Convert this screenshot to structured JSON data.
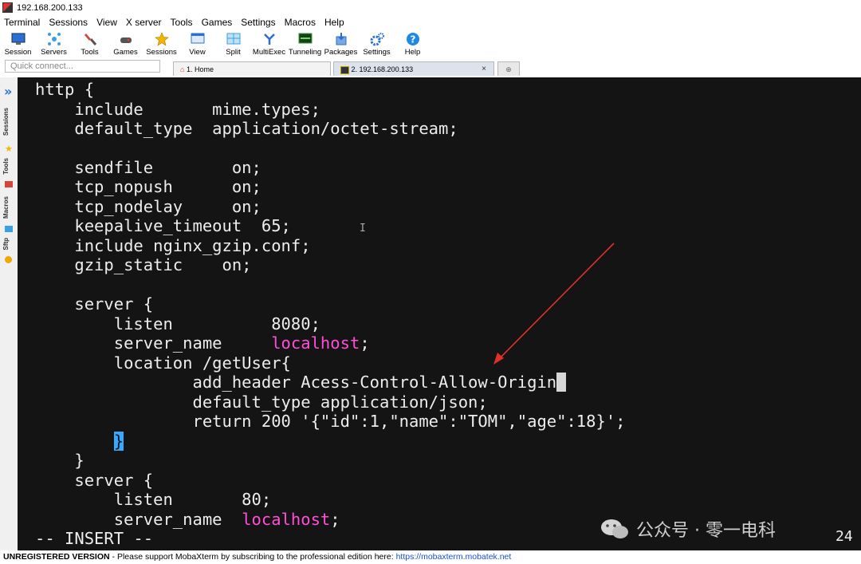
{
  "window": {
    "title": "192.168.200.133"
  },
  "menu": [
    "Terminal",
    "Sessions",
    "View",
    "X server",
    "Tools",
    "Games",
    "Settings",
    "Macros",
    "Help"
  ],
  "toolbar": [
    {
      "label": "Session",
      "icon": "session-icon",
      "color": "#2a6fd6"
    },
    {
      "label": "Servers",
      "icon": "servers-icon",
      "color": "#3aa0e6"
    },
    {
      "label": "Tools",
      "icon": "tools-icon",
      "color": "#d9443a"
    },
    {
      "label": "Games",
      "icon": "games-icon",
      "color": "#555555"
    },
    {
      "label": "Sessions",
      "icon": "star-icon",
      "color": "#f2b600"
    },
    {
      "label": "View",
      "icon": "view-icon",
      "color": "#2a6fd6"
    },
    {
      "label": "Split",
      "icon": "split-icon",
      "color": "#3aa0e6"
    },
    {
      "label": "MultiExec",
      "icon": "multiexec-icon",
      "color": "#2a6fd6"
    },
    {
      "label": "Tunneling",
      "icon": "tunneling-icon",
      "color": "#3a9a3a"
    },
    {
      "label": "Packages",
      "icon": "packages-icon",
      "color": "#2a6fd6"
    },
    {
      "label": "Settings",
      "icon": "gear-icon",
      "color": "#2a6fd6"
    },
    {
      "label": "Help",
      "icon": "help-icon",
      "color": "#1e88e5"
    }
  ],
  "quick_connect": {
    "placeholder": "Quick connect..."
  },
  "tabs": [
    {
      "label": "1. Home",
      "icon": "home-icon"
    },
    {
      "label": "2. 192.168.200.133",
      "icon": "terminal-icon",
      "close": "×"
    }
  ],
  "sidebar": {
    "chevron": "»",
    "tabs": [
      "Sessions",
      "Tools",
      "Macros",
      "Sftp"
    ]
  },
  "terminal": {
    "lines": [
      "http {",
      "    include       mime.types;",
      "    default_type  application/octet-stream;",
      "",
      "    sendfile        on;",
      "    tcp_nopush      on;",
      "    tcp_nodelay     on;",
      "    keepalive_timeout  65;",
      "    include nginx_gzip.conf;",
      "    gzip_static    on;",
      "",
      "    server {",
      "        listen          8080;",
      "        server_name     ",
      "        location /getUser{",
      "                add_header Acess-Control-Allow-Origin",
      "                default_type application/json;",
      "                return 200 '{\"id\":1,\"name\":\"TOM\",\"age\":18}';",
      "        ",
      "    }",
      "    server {",
      "        listen       80;",
      "        server_name  ",
      "-- INSERT --"
    ],
    "highlight_localhost": "localhost",
    "localhost_semicolon": ";",
    "closing_brace": "}",
    "right_edge_number": "24"
  },
  "watermark": "公众号 · 零一电科",
  "status": {
    "registration": "UNREGISTERED VERSION",
    "message": " -  Please support MobaXterm by subscribing to the professional edition here:  ",
    "link": "https://mobaxterm.mobatek.net"
  }
}
